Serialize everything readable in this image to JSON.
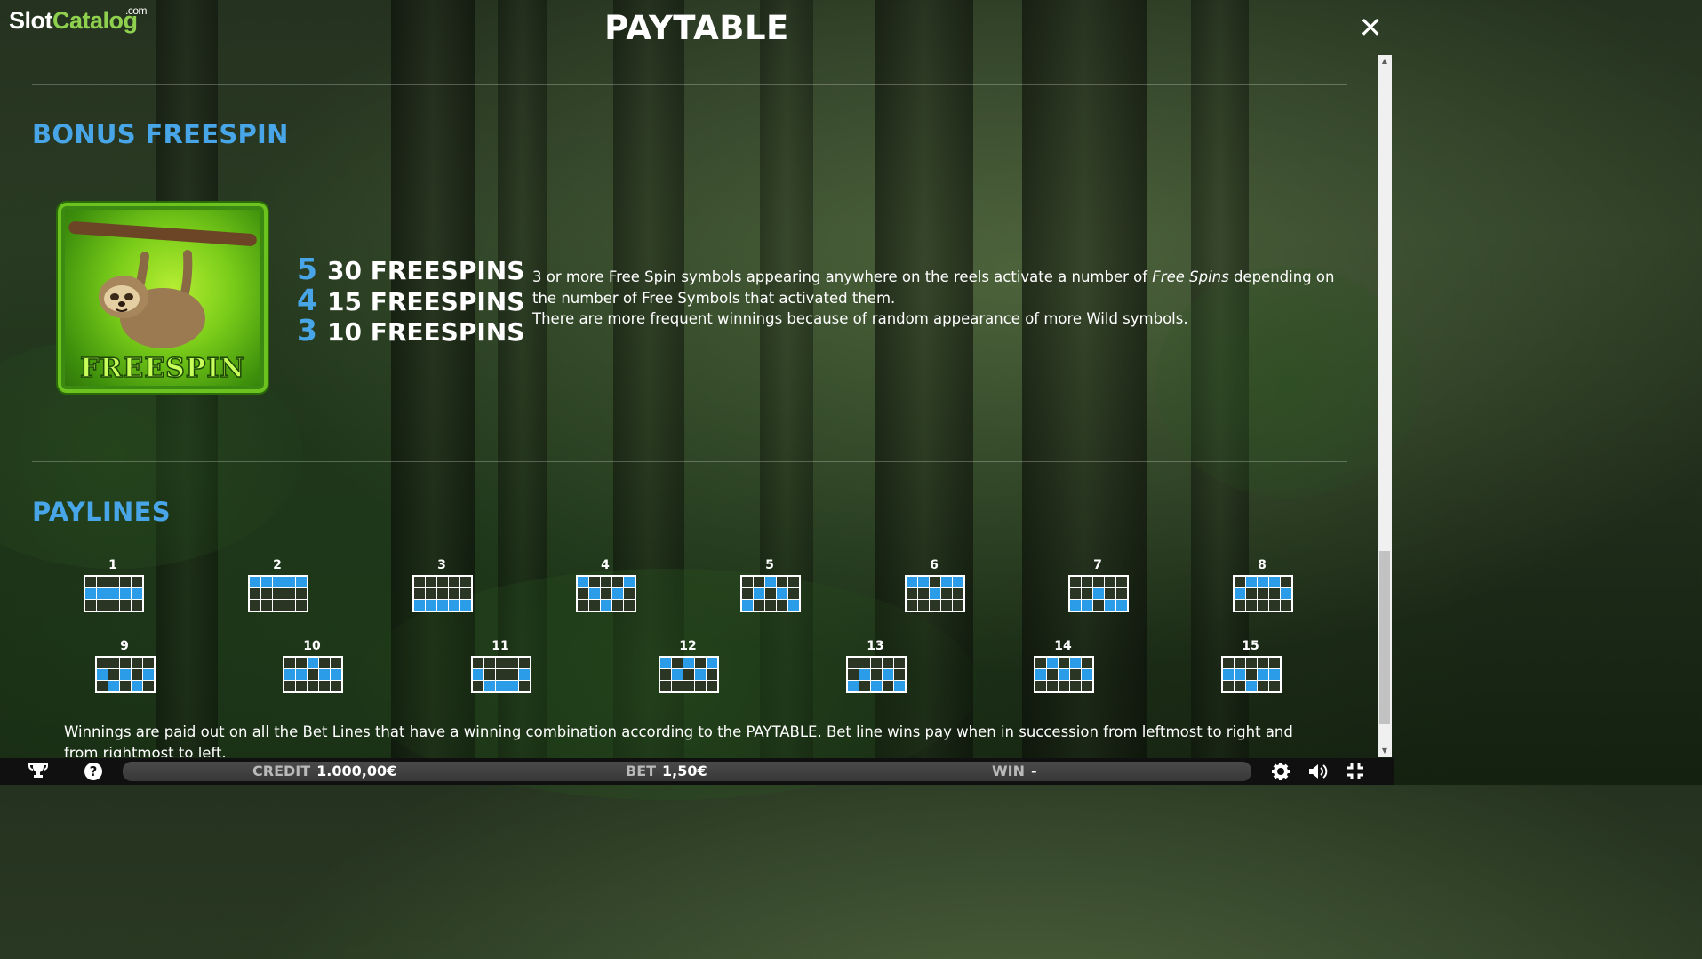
{
  "brand": {
    "slot": "Slot",
    "catalog": "Catalog",
    "com": ".com"
  },
  "header": {
    "title": "PAYTABLE",
    "close_icon": "close-icon"
  },
  "bonus": {
    "title": "BONUS FREESPIN",
    "symbol_label": "FREESPIN",
    "pays": [
      {
        "count": "5",
        "amount": "30 FREESPINS"
      },
      {
        "count": "4",
        "amount": "15 FREESPINS"
      },
      {
        "count": "3",
        "amount": "10 FREESPINS"
      }
    ],
    "desc_line1_a": "3 or more Free Spin symbols appearing anywhere on the reels activate a number of ",
    "desc_line1_em": "Free Spins",
    "desc_line1_b": " depending on the number of Free Symbols that activated them.",
    "desc_line2": "There are more frequent winnings because of random appearance of more Wild symbols."
  },
  "paylines": {
    "title": "PAYLINES",
    "items": [
      {
        "number": "1",
        "rows": [
          1,
          1,
          1,
          1,
          1
        ]
      },
      {
        "number": "2",
        "rows": [
          0,
          0,
          0,
          0,
          0
        ]
      },
      {
        "number": "3",
        "rows": [
          2,
          2,
          2,
          2,
          2
        ]
      },
      {
        "number": "4",
        "rows": [
          0,
          1,
          2,
          1,
          0
        ]
      },
      {
        "number": "5",
        "rows": [
          2,
          1,
          0,
          1,
          2
        ]
      },
      {
        "number": "6",
        "rows": [
          0,
          0,
          1,
          0,
          0
        ]
      },
      {
        "number": "7",
        "rows": [
          2,
          2,
          1,
          2,
          2
        ]
      },
      {
        "number": "8",
        "rows": [
          1,
          0,
          0,
          0,
          1
        ]
      },
      {
        "number": "9",
        "rows": [
          1,
          2,
          1,
          2,
          1
        ]
      },
      {
        "number": "10",
        "rows": [
          1,
          1,
          0,
          1,
          1
        ]
      },
      {
        "number": "11",
        "rows": [
          1,
          2,
          2,
          2,
          1
        ]
      },
      {
        "number": "12",
        "rows": [
          0,
          1,
          0,
          1,
          0
        ]
      },
      {
        "number": "13",
        "rows": [
          2,
          1,
          2,
          1,
          2
        ]
      },
      {
        "number": "14",
        "rows": [
          1,
          0,
          1,
          0,
          1
        ]
      },
      {
        "number": "15",
        "rows": [
          1,
          1,
          2,
          1,
          1
        ]
      }
    ],
    "footnote": "Winnings are paid out on all the Bet Lines that have a winning combination according to the PAYTABLE. Bet line wins pay when in succession from leftmost to right and from rightmost to left."
  },
  "bottom_bar": {
    "credit_label": "CREDIT",
    "credit_value": "1.000,00€",
    "bet_label": "BET",
    "bet_value": "1,50€",
    "win_label": "WIN",
    "win_value": "-",
    "icons": [
      "trophy-icon",
      "help-icon",
      "settings-icon",
      "sound-icon",
      "fullscreen-icon"
    ]
  },
  "colors": {
    "accent": "#48a6e8",
    "line_cell": "#2a9ce8",
    "brand_green": "#8fd14f"
  }
}
